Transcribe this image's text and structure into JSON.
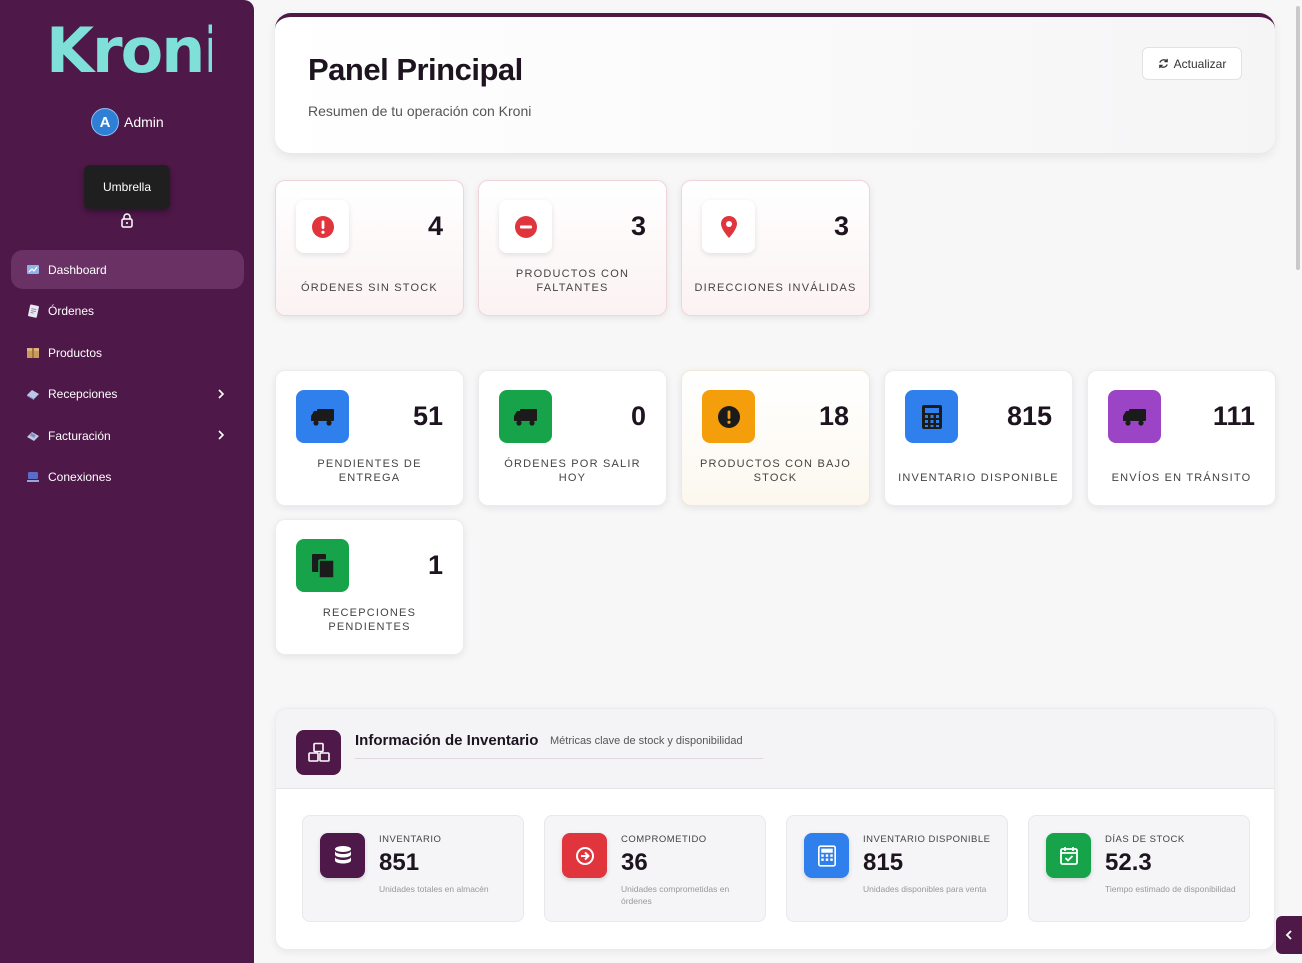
{
  "sidebar": {
    "brand": "Kroni",
    "user": {
      "initial": "A",
      "name": "Admin"
    },
    "company": "Umbrella",
    "nav": [
      {
        "label": "Dashboard",
        "active": true,
        "icon": "dashboard-icon"
      },
      {
        "label": "Órdenes",
        "icon": "orders-icon"
      },
      {
        "label": "Productos",
        "icon": "products-icon"
      },
      {
        "label": "Recepciones",
        "icon": "receptions-icon",
        "has_submenu": true
      },
      {
        "label": "Facturación",
        "icon": "billing-icon",
        "has_submenu": true
      },
      {
        "label": "Conexiones",
        "icon": "connections-icon"
      }
    ]
  },
  "header": {
    "title": "Panel Principal",
    "subtitle": "Resumen de tu operación con Kroni",
    "refresh_label": "Actualizar"
  },
  "alerts": [
    {
      "value": "4",
      "label": "ÓRDENES SIN STOCK",
      "icon": "exclamation-circle-icon",
      "color": "#e0353d"
    },
    {
      "value": "3",
      "label": "PRODUCTOS CON FALTANTES",
      "icon": "minus-circle-icon",
      "color": "#e0353d"
    },
    {
      "value": "3",
      "label": "DIRECCIONES INVÁLIDAS",
      "icon": "map-pin-icon",
      "color": "#e0353d"
    }
  ],
  "stats": [
    {
      "value": "51",
      "label": "PENDIENTES DE ENTREGA",
      "icon": "truck-icon",
      "color": "#2f80ed"
    },
    {
      "value": "0",
      "label": "ÓRDENES POR SALIR HOY",
      "icon": "truck-icon",
      "color": "#16a34a"
    },
    {
      "value": "18",
      "label": "PRODUCTOS CON BAJO STOCK",
      "icon": "exclamation-circle-icon",
      "color": "#f59e0b"
    },
    {
      "value": "815",
      "label": "INVENTARIO DISPONIBLE",
      "icon": "calculator-icon",
      "color": "#2f80ed"
    },
    {
      "value": "111",
      "label": "ENVÍOS EN TRÁNSITO",
      "icon": "truck-icon",
      "color": "#9b44c6"
    },
    {
      "value": "1",
      "label": "RECEPCIONES PENDIENTES",
      "icon": "documents-icon",
      "color": "#16a34a"
    }
  ],
  "inventory": {
    "title": "Información de Inventario",
    "subtitle": "Métricas clave de stock y disponibilidad",
    "metrics": [
      {
        "label": "INVENTARIO",
        "value": "851",
        "desc": "Unidades totales en almacén",
        "icon": "database-icon",
        "color": "#4e1849"
      },
      {
        "label": "COMPROMETIDO",
        "value": "36",
        "desc": "Unidades comprometidas en órdenes",
        "icon": "arrow-circle-icon",
        "color": "#e0353d"
      },
      {
        "label": "INVENTARIO DISPONIBLE",
        "value": "815",
        "desc": "Unidades disponibles para venta",
        "icon": "calculator-icon",
        "color": "#2f80ed"
      },
      {
        "label": "DÍAS DE STOCK",
        "value": "52.3",
        "desc": "Tiempo estimado de disponibilidad",
        "icon": "calendar-check-icon",
        "color": "#16a34a"
      }
    ]
  }
}
